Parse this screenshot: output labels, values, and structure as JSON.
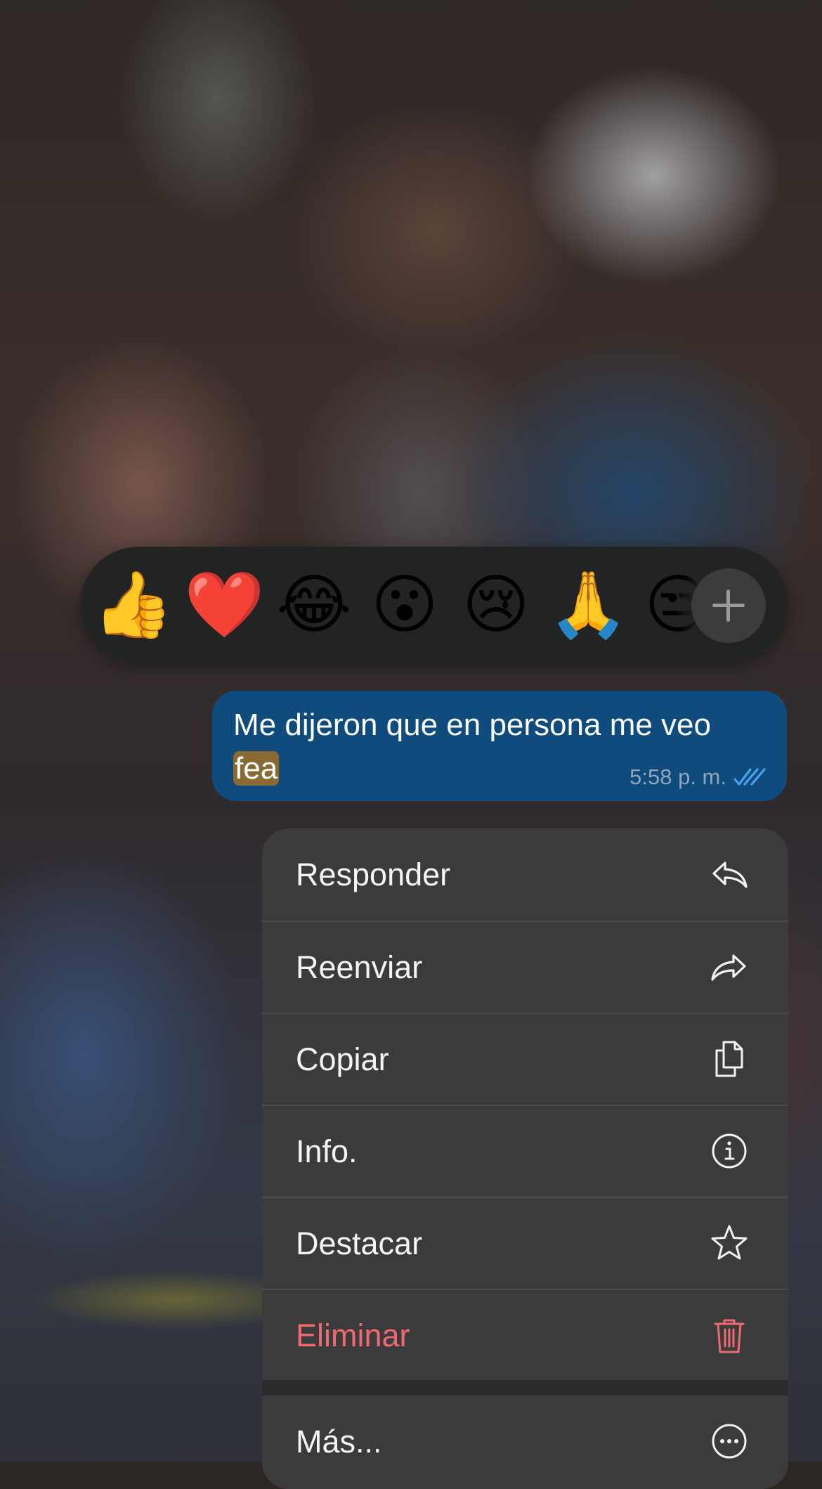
{
  "reactions": {
    "emojis": [
      "👍",
      "❤️",
      "😂",
      "😮",
      "😢",
      "🙏",
      "😒"
    ],
    "add_icon": "plus-icon"
  },
  "message": {
    "text_before": "Me dijeron que en persona me veo",
    "highlighted_word": "fea",
    "time": "5:58 p. m.",
    "status_icon": "double-check-icon",
    "bubble_color": "#0f4b7c",
    "highlight_color": "#8a6a33"
  },
  "menu": {
    "items": [
      {
        "label": "Responder",
        "icon": "reply-icon"
      },
      {
        "label": "Reenviar",
        "icon": "forward-icon"
      },
      {
        "label": "Copiar",
        "icon": "copy-icon"
      },
      {
        "label": "Info.",
        "icon": "info-icon"
      },
      {
        "label": "Destacar",
        "icon": "star-icon"
      },
      {
        "label": "Eliminar",
        "icon": "trash-icon"
      }
    ],
    "more": {
      "label": "Más...",
      "icon": "more-icon"
    },
    "danger_color": "#ee6a73"
  }
}
